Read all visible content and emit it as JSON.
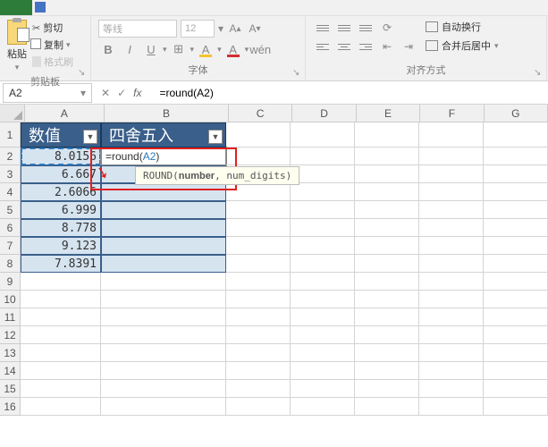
{
  "ribbon": {
    "clipboard": {
      "paste": "粘贴",
      "cut": "剪切",
      "copy": "复制",
      "format_painter": "格式刷",
      "group_label": "剪贴板"
    },
    "font": {
      "name_placeholder": "等线",
      "size_placeholder": "12",
      "group_label": "字体"
    },
    "align": {
      "wrap": "自动换行",
      "merge": "合并后居中",
      "group_label": "对齐方式"
    }
  },
  "namebox": "A2",
  "formula": "=round(A2)",
  "columns": [
    "A",
    "B",
    "C",
    "D",
    "E",
    "F",
    "G"
  ],
  "row_labels": [
    "1",
    "2",
    "3",
    "4",
    "5",
    "6",
    "7",
    "8",
    "9",
    "10",
    "11",
    "12",
    "13",
    "14",
    "15",
    "16"
  ],
  "headers": {
    "a": "数值",
    "b": "四舍五入"
  },
  "data_a": [
    "8.0156",
    "6.667",
    "2.6066",
    "6.999",
    "8.778",
    "9.123",
    "7.8391"
  ],
  "formula_cell_prefix": "=round(",
  "formula_cell_ref": "A2",
  "formula_cell_suffix": ")",
  "tooltip": {
    "func": "ROUND(",
    "arg1": "number",
    "rest": ", num_digits)"
  }
}
